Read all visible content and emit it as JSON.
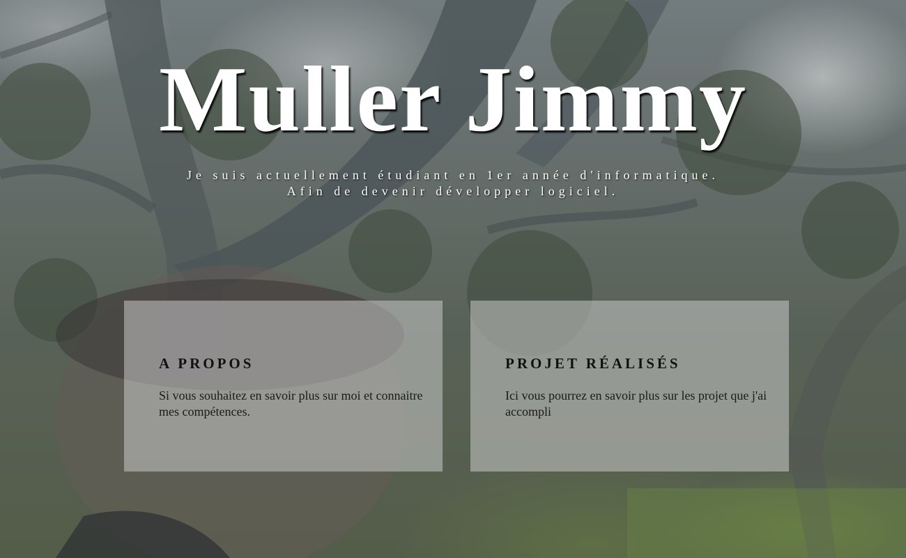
{
  "hero": {
    "title": "Muller Jimmy",
    "subtitle_line1": "Je suis actuellement étudiant en 1er année d'informatique.",
    "subtitle_line2": "Afin de devenir développer logiciel."
  },
  "cards": [
    {
      "heading": "A PROPOS",
      "text": "Si vous souhaitez en savoir plus sur moi et connaitre mes compétences."
    },
    {
      "heading": "PROJET RÉALISÉS",
      "text": "Ici vous pourrez en savoir plus sur les projet que j'ai accompli"
    }
  ],
  "colors": {
    "title": "#ffffff",
    "card_background": "#c8c8c8",
    "card_text": "#111111"
  }
}
